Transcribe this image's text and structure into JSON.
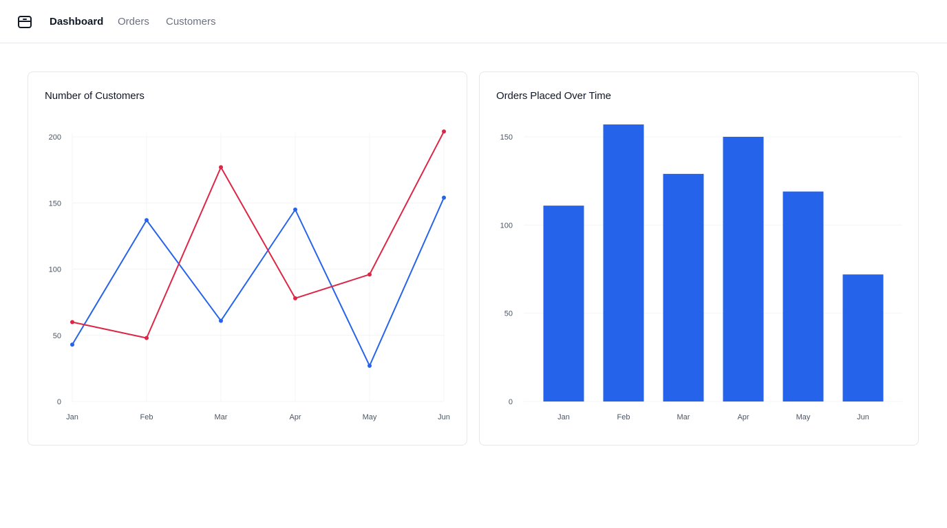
{
  "nav": {
    "logo_icon": "package-icon",
    "links": [
      {
        "label": "Dashboard",
        "active": true
      },
      {
        "label": "Orders",
        "active": false
      },
      {
        "label": "Customers",
        "active": false
      }
    ]
  },
  "colors": {
    "series_blue": "#2563eb",
    "series_red": "#dc2645",
    "grid": "#f3f4f6",
    "bar": "#2563eb"
  },
  "cards": {
    "customers_title": "Number of Customers",
    "orders_title": "Orders Placed Over Time"
  },
  "chart_data": [
    {
      "type": "line",
      "title": "Number of Customers",
      "xlabel": "",
      "ylabel": "",
      "categories": [
        "Jan",
        "Feb",
        "Mar",
        "Apr",
        "May",
        "Jun"
      ],
      "ylim": [
        0,
        200
      ],
      "yticks": [
        0,
        50,
        100,
        150,
        200
      ],
      "grid": true,
      "series": [
        {
          "color": "#2563eb",
          "values": [
            43,
            137,
            61,
            145,
            27,
            154
          ]
        },
        {
          "color": "#dc2645",
          "values": [
            60,
            48,
            177,
            78,
            96,
            204
          ]
        }
      ]
    },
    {
      "type": "bar",
      "title": "Orders Placed Over Time",
      "xlabel": "",
      "ylabel": "",
      "categories": [
        "Jan",
        "Feb",
        "Mar",
        "Apr",
        "May",
        "Jun"
      ],
      "values": [
        111,
        157,
        129,
        150,
        119,
        72
      ],
      "ylim": [
        0,
        150
      ],
      "yticks": [
        0,
        50,
        100,
        150
      ],
      "grid": true
    }
  ]
}
